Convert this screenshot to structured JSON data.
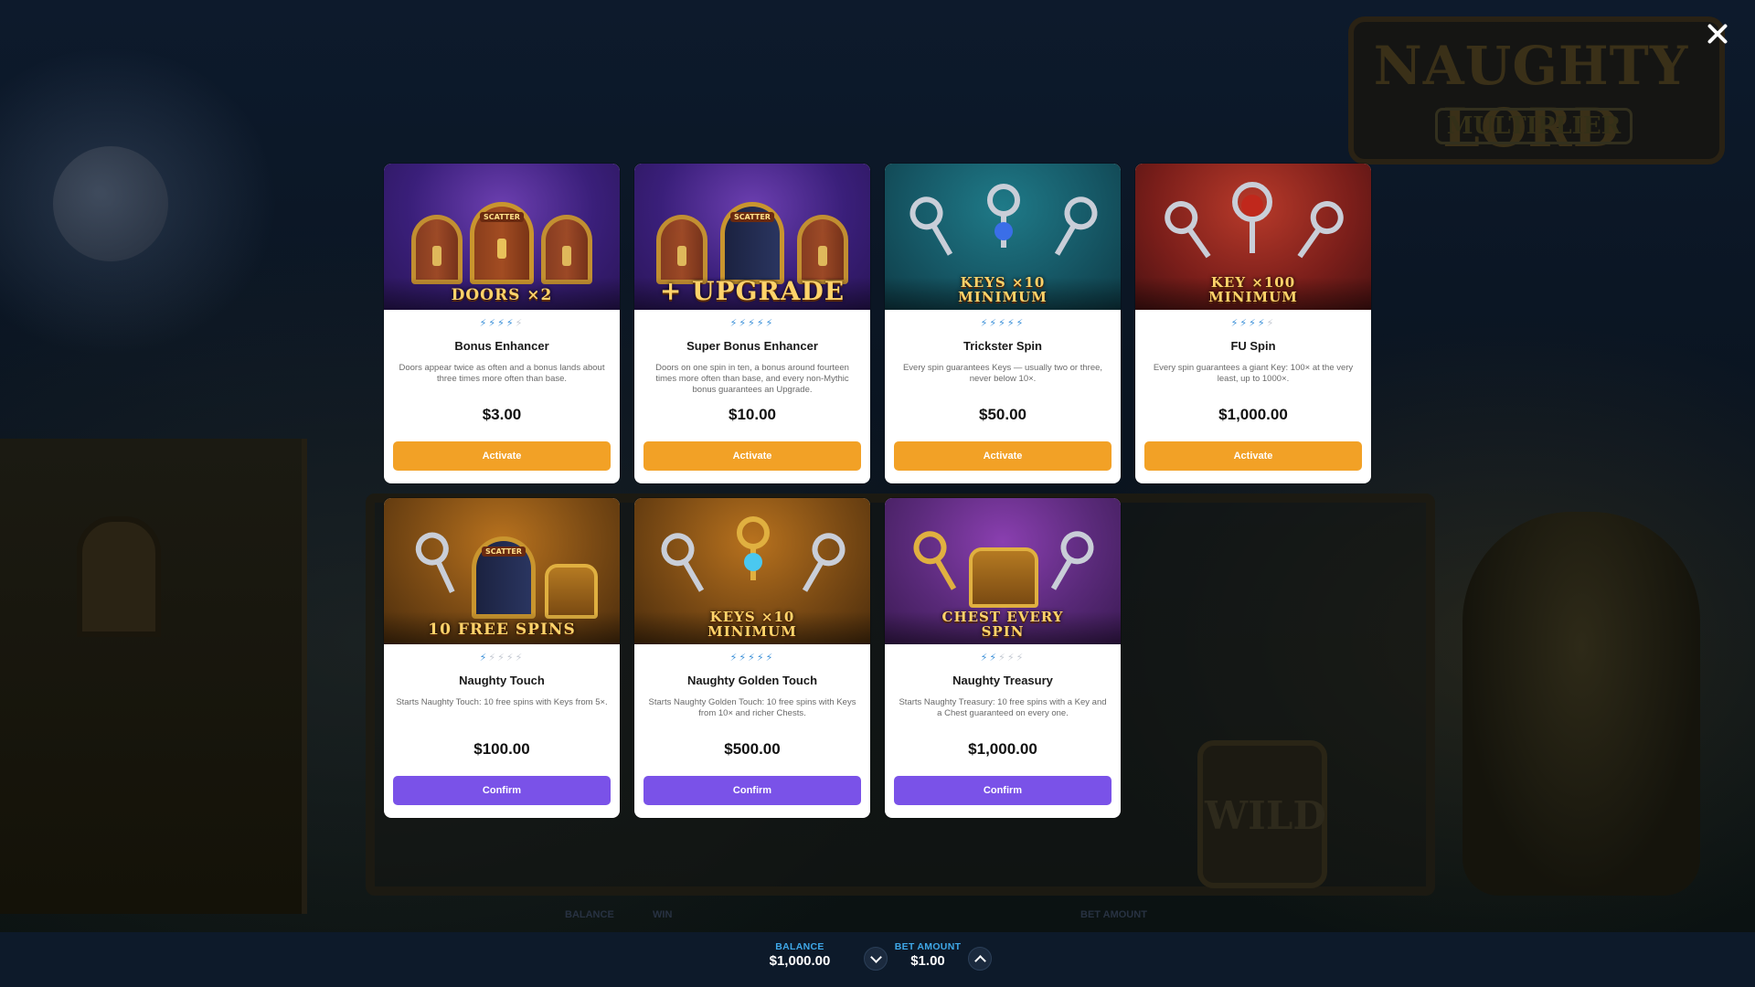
{
  "game": {
    "logo_title": "NAUGHTY LORD",
    "logo_subtitle": "MULTIPLIER",
    "reel_wild_label": "WILD"
  },
  "colors": {
    "activate_button": "#f2a126",
    "confirm_button": "#7a52e8",
    "star_active": "#3a8fd8",
    "hud_label": "#3fa8e8"
  },
  "cards": [
    {
      "art_caption": "DOORS ×2",
      "stars_filled": 4,
      "stars_total": 5,
      "title": "Bonus Enhancer",
      "description": "Doors appear twice as often and a bonus lands about three times more often than base.",
      "price": "$3.00",
      "button": "Activate"
    },
    {
      "art_caption": "+ UPGRADE",
      "stars_filled": 5,
      "stars_total": 5,
      "title": "Super Bonus Enhancer",
      "description": "Doors on one spin in ten, a bonus around fourteen times more often than base, and every non-Mythic bonus guarantees an Upgrade.",
      "price": "$10.00",
      "button": "Activate"
    },
    {
      "art_caption_line1": "KEYS ×10",
      "art_caption_line2": "MINIMUM",
      "stars_filled": 5,
      "stars_total": 5,
      "title": "Trickster Spin",
      "description": "Every spin guarantees Keys — usually two or three, never below 10×.",
      "price": "$50.00",
      "button": "Activate"
    },
    {
      "art_caption_line1": "KEY ×100",
      "art_caption_line2": "MINIMUM",
      "stars_filled": 4,
      "stars_total": 5,
      "title": "FU Spin",
      "description": "Every spin guarantees a giant Key: 100× at the very least, up to 1000×.",
      "price": "$1,000.00",
      "button": "Activate"
    },
    {
      "art_caption": "10 FREE SPINS",
      "stars_filled": 1,
      "stars_total": 5,
      "title": "Naughty Touch",
      "description": "Starts Naughty Touch: 10 free spins with Keys from 5×.",
      "price": "$100.00",
      "button": "Confirm"
    },
    {
      "art_caption_line1": "KEYS ×10",
      "art_caption_line2": "MINIMUM",
      "stars_filled": 5,
      "stars_total": 5,
      "title": "Naughty Golden Touch",
      "description": "Starts Naughty Golden Touch: 10 free spins with Keys from 10× and richer Chests.",
      "price": "$500.00",
      "button": "Confirm"
    },
    {
      "art_caption_line1": "CHEST EVERY",
      "art_caption_line2": "SPIN",
      "stars_filled": 2,
      "stars_total": 5,
      "title": "Naughty Treasury",
      "description": "Starts Naughty Treasury: 10 free spins with a Key and a Chest guaranteed on every one.",
      "price": "$1,000.00",
      "button": "Confirm"
    }
  ],
  "bottom_bar": {
    "balance_label": "BALANCE",
    "balance_value": "$1,000.00",
    "bet_label": "BET AMOUNT",
    "bet_value": "$1.00"
  },
  "background_hud": {
    "balance_label": "BALANCE",
    "win_label": "WIN",
    "bet_label": "BET AMOUNT"
  },
  "icons": {
    "close": "close-icon",
    "bet_decrease": "chevron-down-icon",
    "bet_increase": "chevron-up-icon",
    "star": "lightning-star-icon"
  }
}
